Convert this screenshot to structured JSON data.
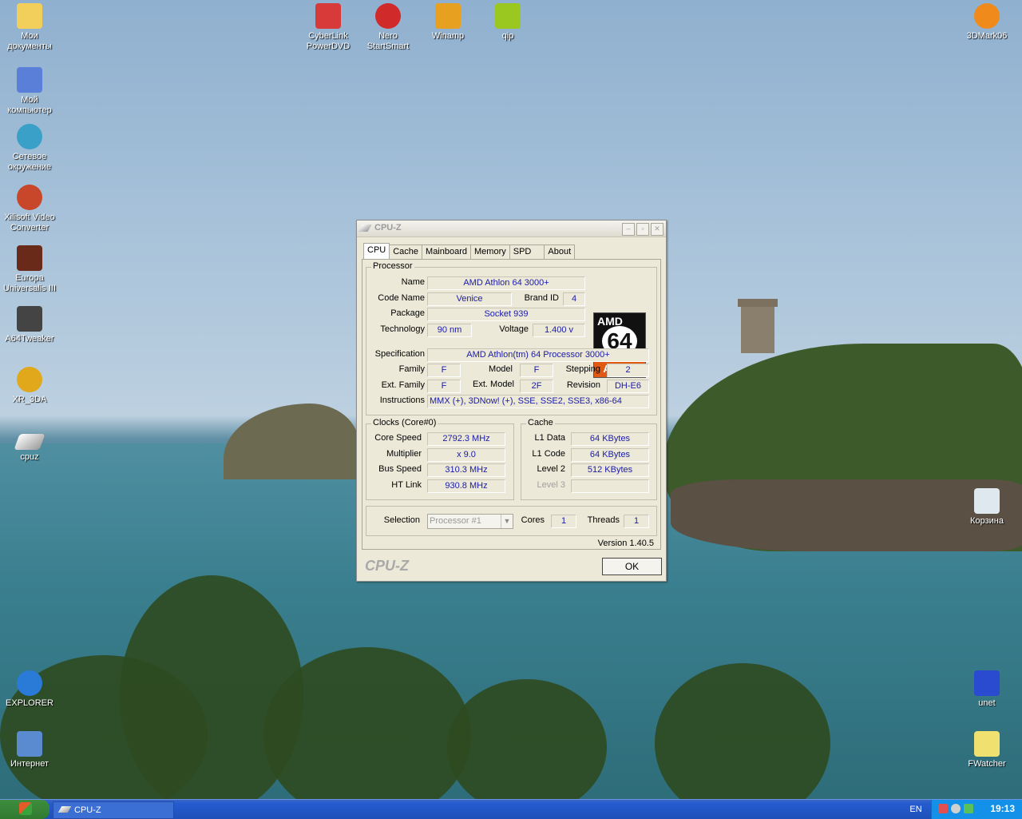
{
  "desktop": {
    "left_icons": [
      {
        "label": "Мои документы"
      },
      {
        "label": "Мой компьютер"
      },
      {
        "label": "Сетевое окружение"
      },
      {
        "label": "Xilisoft Video Converter"
      },
      {
        "label": "Europa Universalis III"
      },
      {
        "label": "A64Tweaker"
      },
      {
        "label": "XR_3DA"
      },
      {
        "label": "cpuz"
      },
      {
        "label": "EXPLORER"
      },
      {
        "label": "Интернет"
      }
    ],
    "top_icons": [
      {
        "label": "CyberLink PowerDVD"
      },
      {
        "label": "Nero StartSmart"
      },
      {
        "label": "Winamp"
      },
      {
        "label": "qip"
      }
    ],
    "right_icons": [
      {
        "label": "3DMark06"
      },
      {
        "label": "Корзина"
      },
      {
        "label": "unet"
      },
      {
        "label": "FWatcher"
      }
    ]
  },
  "window": {
    "title": "CPU-Z",
    "tabs": [
      {
        "label": "CPU"
      },
      {
        "label": "Cache"
      },
      {
        "label": "Mainboard"
      },
      {
        "label": "Memory"
      },
      {
        "label": "SPD"
      },
      {
        "label": "About"
      }
    ],
    "processor": {
      "group_label": "Processor",
      "name_label": "Name",
      "name": "AMD Athlon 64 3000+",
      "code_name_label": "Code Name",
      "code_name": "Venice",
      "brand_id_label": "Brand ID",
      "brand_id": "4",
      "package_label": "Package",
      "package": "Socket 939",
      "technology_label": "Technology",
      "technology": "90 nm",
      "voltage_label": "Voltage",
      "voltage": "1.400 v",
      "specification_label": "Specification",
      "specification": "AMD Athlon(tm) 64 Processor 3000+",
      "family_label": "Family",
      "family": "F",
      "model_label": "Model",
      "model": "F",
      "stepping_label": "Stepping",
      "stepping": "2",
      "ext_family_label": "Ext. Family",
      "ext_family": "F",
      "ext_model_label": "Ext. Model",
      "ext_model": "2F",
      "revision_label": "Revision",
      "revision": "DH-E6",
      "instructions_label": "Instructions",
      "instructions": "MMX (+), 3DNow! (+), SSE, SSE2, SSE3, x86-64",
      "logo": {
        "brand": "AMD",
        "number": "64",
        "line": "Athlon"
      }
    },
    "clocks": {
      "group_label": "Clocks (Core#0)",
      "core_speed_label": "Core Speed",
      "core_speed": "2792.3 MHz",
      "multiplier_label": "Multiplier",
      "multiplier": "x 9.0",
      "bus_speed_label": "Bus Speed",
      "bus_speed": "310.3 MHz",
      "ht_link_label": "HT Link",
      "ht_link": "930.8 MHz"
    },
    "cache": {
      "group_label": "Cache",
      "l1_data_label": "L1 Data",
      "l1_data": "64 KBytes",
      "l1_code_label": "L1 Code",
      "l1_code": "64 KBytes",
      "level2_label": "Level 2",
      "level2": "512 KBytes",
      "level3_label": "Level 3",
      "level3": ""
    },
    "selection": {
      "label": "Selection",
      "value": "Processor #1",
      "cores_label": "Cores",
      "cores": "1",
      "threads_label": "Threads",
      "threads": "1"
    },
    "version": "Version 1.40.5",
    "brand_footer": "CPU-Z",
    "ok_label": "OK"
  },
  "taskbar": {
    "item_label": "CPU-Z",
    "language": "EN",
    "clock": "19:13"
  }
}
